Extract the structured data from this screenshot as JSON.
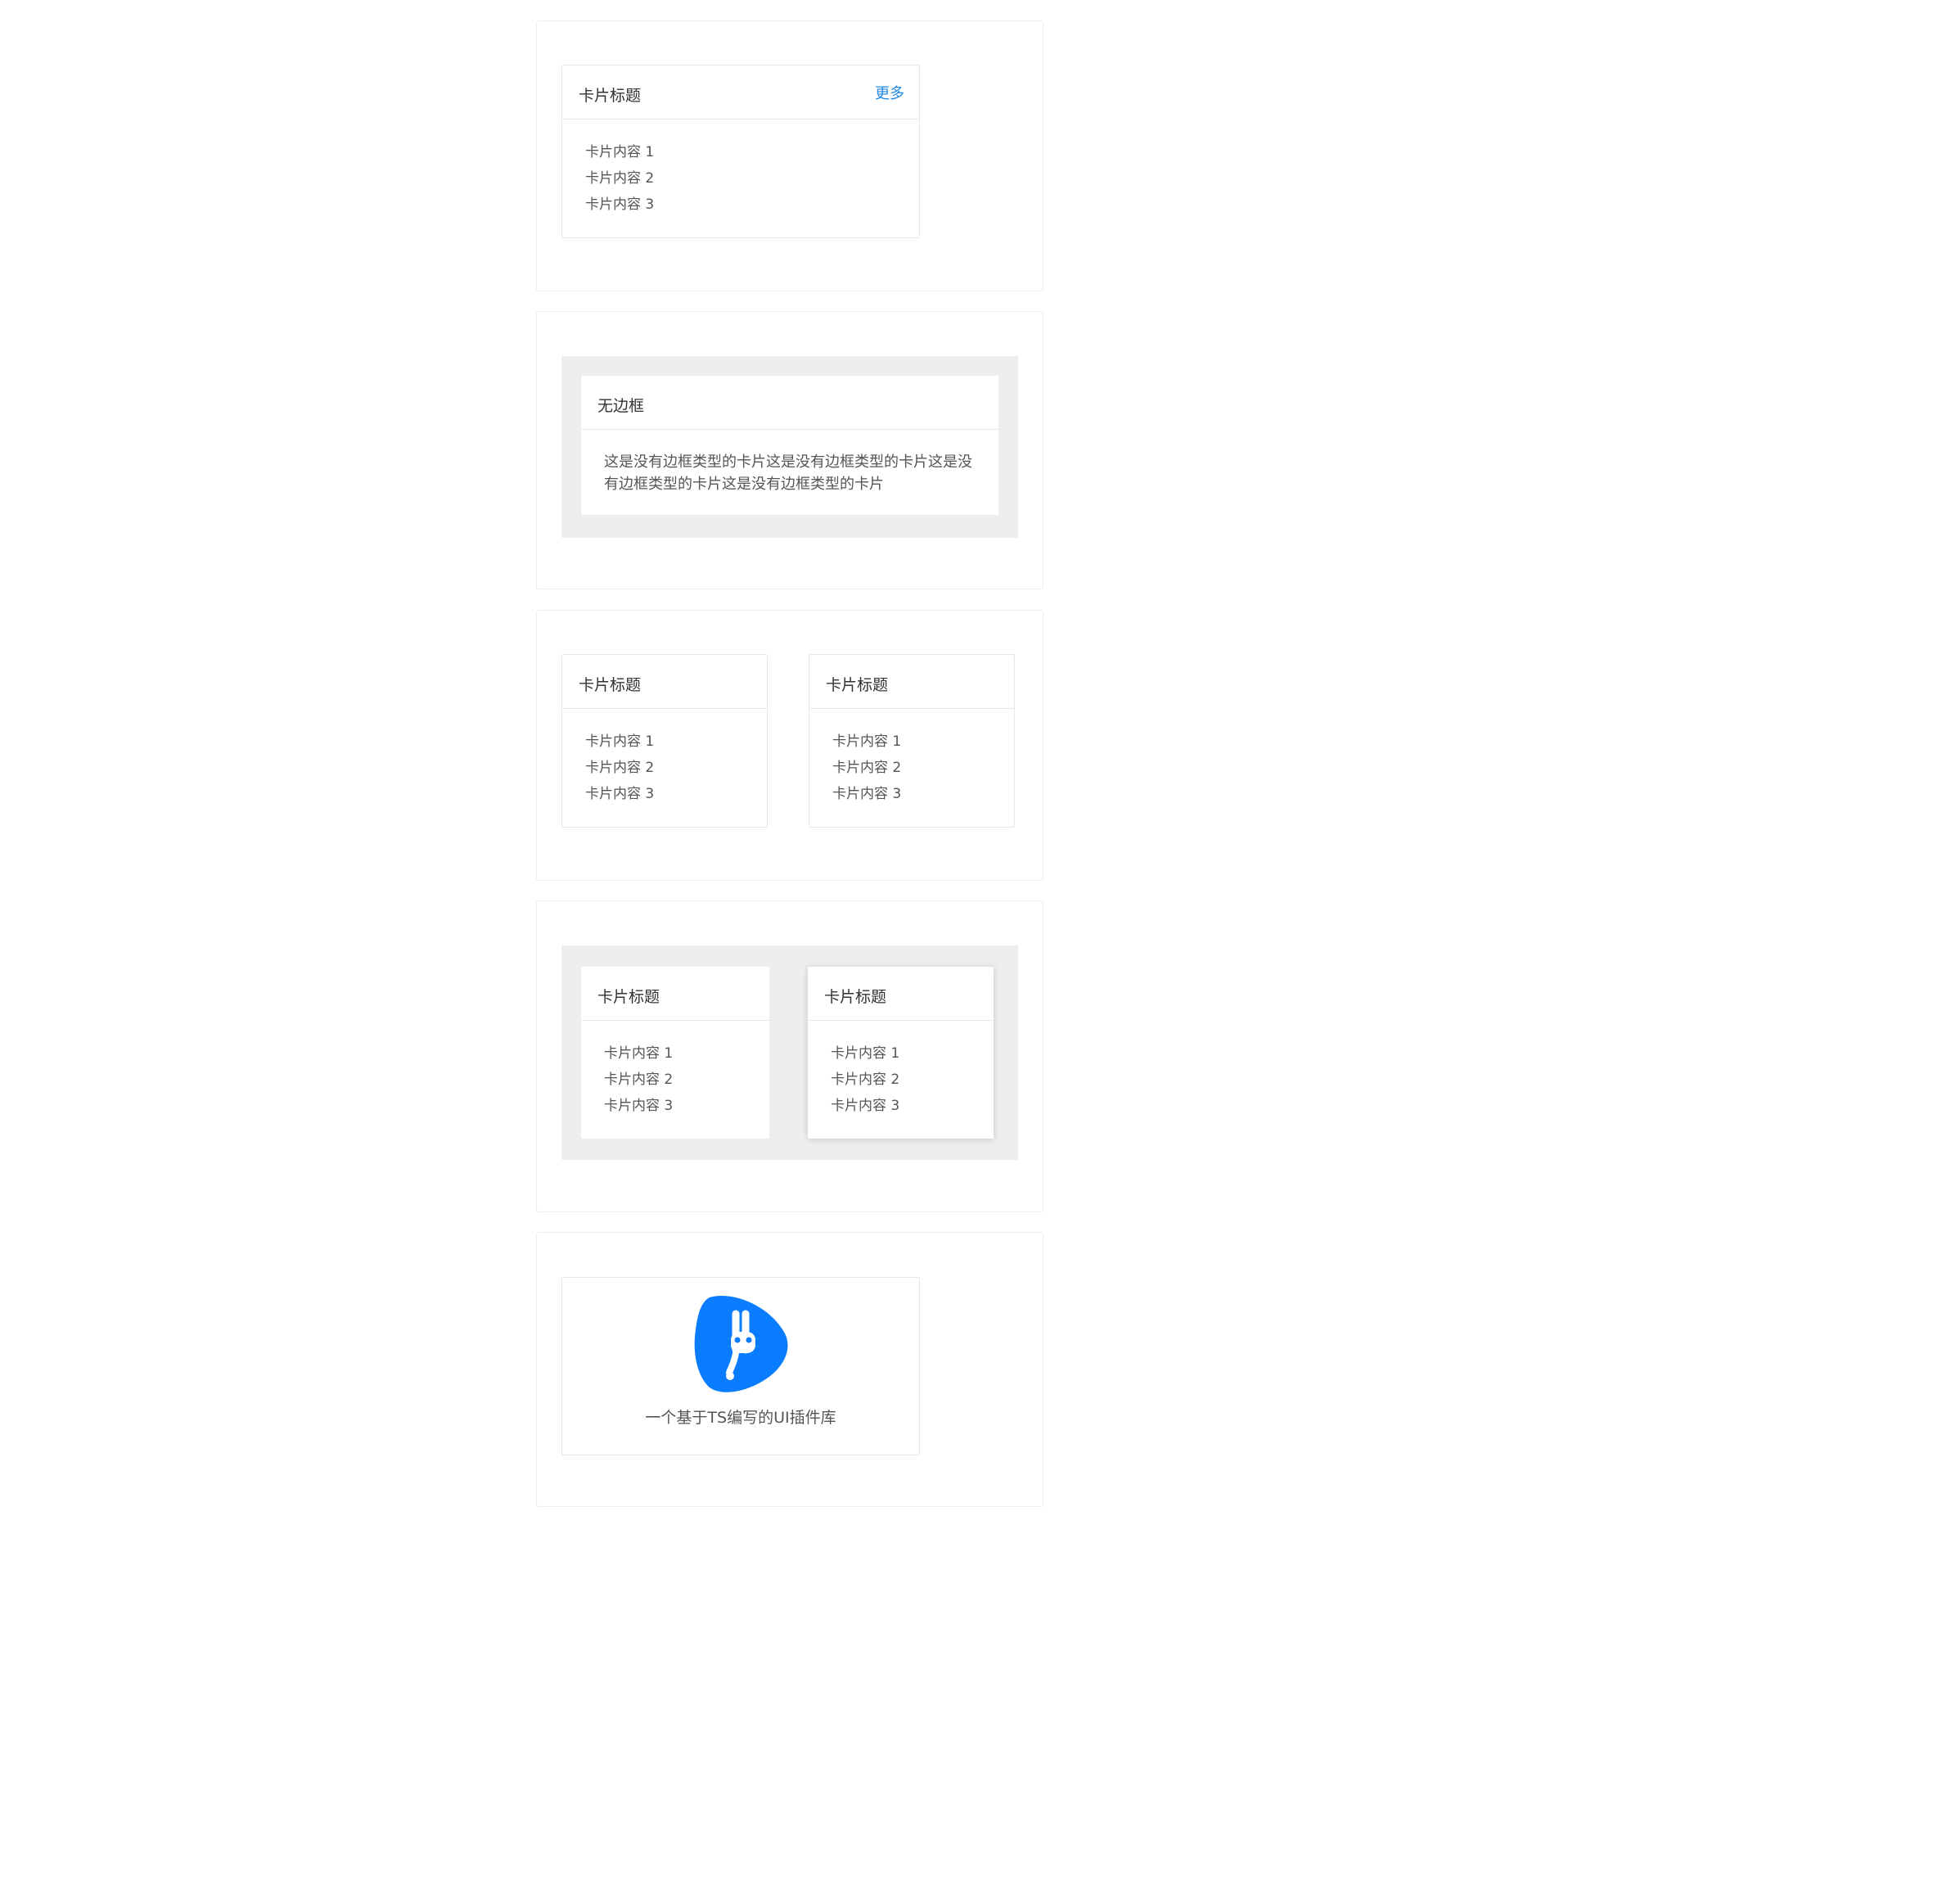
{
  "demo1": {
    "card": {
      "title": "卡片标题",
      "more": "更多",
      "lines": [
        "卡片内容 1",
        "卡片内容 2",
        "卡片内容 3"
      ]
    }
  },
  "demo2": {
    "card": {
      "title": "无边框",
      "body": "这是没有边框类型的卡片这是没有边框类型的卡片这是没有边框类型的卡片这是没有边框类型的卡片"
    }
  },
  "demo3": {
    "cards": [
      {
        "title": "卡片标题",
        "lines": [
          "卡片内容 1",
          "卡片内容 2",
          "卡片内容 3"
        ]
      },
      {
        "title": "卡片标题",
        "lines": [
          "卡片内容 1",
          "卡片内容 2",
          "卡片内容 3"
        ]
      }
    ]
  },
  "demo4": {
    "cards": [
      {
        "title": "卡片标题",
        "lines": [
          "卡片内容 1",
          "卡片内容 2",
          "卡片内容 3"
        ]
      },
      {
        "title": "卡片标题",
        "lines": [
          "卡片内容 1",
          "卡片内容 2",
          "卡片内容 3"
        ]
      }
    ]
  },
  "demo5": {
    "logo_icon": "rabbit-logo-icon",
    "logo_color": "#0a7cff",
    "caption": "一个基于TS编写的UI插件库"
  }
}
